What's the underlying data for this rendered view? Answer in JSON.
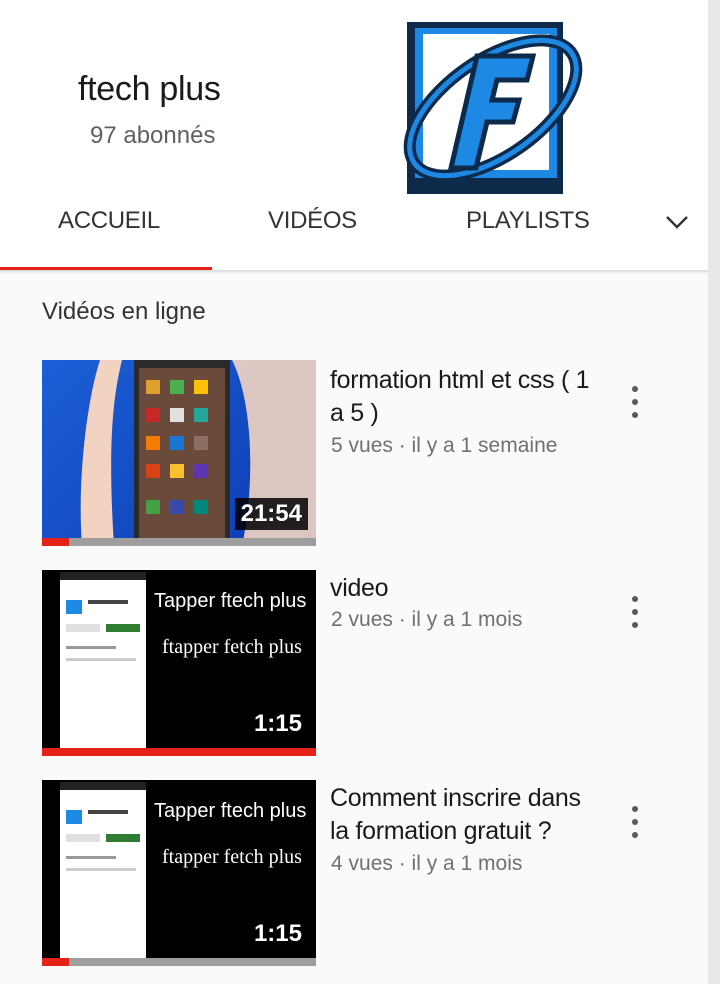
{
  "channel": {
    "name": "ftech plus",
    "subscribers": "97 abonnés",
    "logo_icon": "channel-logo-f"
  },
  "tabs": [
    {
      "label": "ACCUEIL",
      "active": true
    },
    {
      "label": "VIDÉOS",
      "active": false
    },
    {
      "label": "PLAYLISTS",
      "active": false
    }
  ],
  "tabs_more_icon": "chevron-down-icon",
  "section": {
    "title": "Vidéos en ligne"
  },
  "videos": [
    {
      "title": "formation html et css ( 1 a 5 )",
      "meta": "5 vues · il y a 1 semaine",
      "duration": "21:54",
      "watched_fraction": 0.1
    },
    {
      "title": "video",
      "meta": "2 vues · il y a 1 mois",
      "duration": "1:15",
      "thumb_line1": "Tapper ftech plus",
      "thumb_line2": "ftapper fetch plus",
      "watched_fraction": 1.0
    },
    {
      "title": "Comment inscrire dans la formation gratuit ?",
      "meta": "4 vues · il y a 1 mois",
      "duration": "1:15",
      "thumb_line1": "Tapper ftech plus",
      "thumb_line2": "ftapper fetch plus",
      "watched_fraction": 0.1
    }
  ],
  "colors": {
    "accent": "#e62117",
    "logo_blue": "#1e88e5",
    "logo_navy": "#0d2a4a"
  }
}
